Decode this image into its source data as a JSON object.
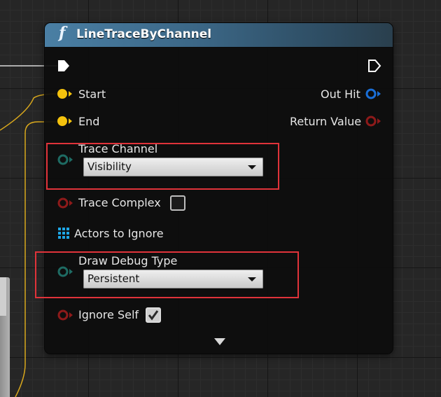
{
  "node": {
    "function_glyph": "f",
    "title": "LineTraceByChannel",
    "inputs": {
      "start": "Start",
      "end": "End",
      "trace_channel": {
        "label": "Trace Channel",
        "value": "Visibility"
      },
      "trace_complex": {
        "label": "Trace Complex",
        "checked": false
      },
      "actors_to_ignore": "Actors to Ignore",
      "draw_debug_type": {
        "label": "Draw Debug Type",
        "value": "Persistent"
      },
      "ignore_self": {
        "label": "Ignore Self",
        "checked": true
      }
    },
    "outputs": {
      "out_hit": "Out Hit",
      "return_value": "Return Value"
    }
  },
  "colors": {
    "vector_pin": "#f4c20d",
    "struct_pin": "#1a6fd8",
    "bool_pin": "#8e1a1a",
    "enum_pin": "#1e6b63",
    "array_pin": "#1ea6e6",
    "highlight": "#e0333a",
    "wire_exec": "#ffffff",
    "wire_vector": "#e0b01e"
  },
  "icons": [
    "exec-in-icon",
    "exec-out-icon",
    "function-icon",
    "dropdown-caret-icon",
    "array-grid-icon",
    "expand-arrow-icon"
  ]
}
